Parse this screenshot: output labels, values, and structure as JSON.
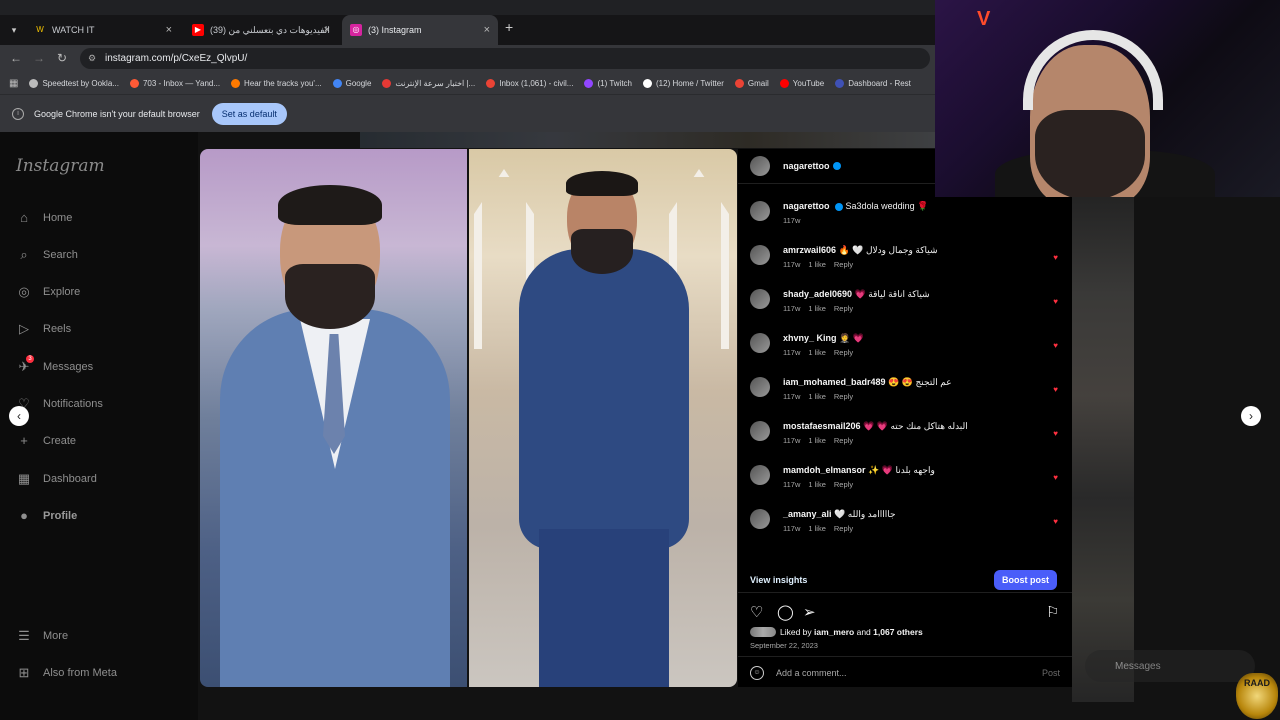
{
  "browser": {
    "tabs": [
      {
        "label": "WATCH IT",
        "fav_color": "#f2c200",
        "fav_glyph": "W"
      },
      {
        "label": "الفيديوهات دي بتعسلني من (39)",
        "fav_color": "#ff0000",
        "fav_glyph": "▶"
      },
      {
        "label": "(3) Instagram",
        "fav_color": "#d6249f",
        "fav_glyph": "◎"
      }
    ],
    "close_glyph": "×",
    "new_tab_glyph": "+",
    "url": "instagram.com/p/CxeEz_QlvpU/",
    "bookmarks": [
      {
        "label": "Speedtest by Ookla...",
        "color": "#bbbbbb"
      },
      {
        "label": "703 - Inbox — Yand...",
        "color": "#ff5a36"
      },
      {
        "label": "Hear the tracks you'...",
        "color": "#ff7a00"
      },
      {
        "label": "Google",
        "color": "#4285f4"
      },
      {
        "label": "اختبار سرعة الإنترنت |...",
        "color": "#e53935"
      },
      {
        "label": "Inbox (1,061) - civil...",
        "color": "#ea4335"
      },
      {
        "label": "(1) Twitch",
        "color": "#9146ff"
      },
      {
        "label": "(12) Home / Twitter",
        "color": "#ffffff"
      },
      {
        "label": "Gmail",
        "color": "#ea4335"
      },
      {
        "label": "YouTube",
        "color": "#ff0000"
      },
      {
        "label": "Dashboard - Rest",
        "color": "#3f51b5"
      }
    ],
    "infobar_message": "Google Chrome isn't your default browser",
    "set_default_label": "Set as default"
  },
  "sidebar": {
    "logo": "Instagram",
    "items": [
      {
        "label": "Home",
        "icon": "⌂"
      },
      {
        "label": "Search",
        "icon": "⌕"
      },
      {
        "label": "Explore",
        "icon": "◎"
      },
      {
        "label": "Reels",
        "icon": "▷"
      },
      {
        "label": "Messages",
        "icon": "✈",
        "badge": "3"
      },
      {
        "label": "Notifications",
        "icon": "♡"
      },
      {
        "label": "Create",
        "icon": "+"
      },
      {
        "label": "Dashboard",
        "icon": "▦"
      },
      {
        "label": "Profile",
        "icon": "●"
      }
    ],
    "more_label": "More",
    "meta_label": "Also from Meta"
  },
  "post": {
    "author": "nagarettoo",
    "caption_user": "nagarettoo",
    "caption": "Sa3dola wedding 🌹",
    "caption_time": "117w",
    "comments": [
      {
        "user": "amrzwail606",
        "text": "🔥 🤍 شياكة وجمال ودلال",
        "time": "117w",
        "likes": "1 like",
        "reply": "Reply"
      },
      {
        "user": "shady_adel0690",
        "text": "💗 شياكة اناقة لياقة",
        "time": "117w",
        "likes": "1 like",
        "reply": "Reply"
      },
      {
        "user": "xhvny_ King",
        "text": "🤵 💗",
        "time": "117w",
        "likes": "1 like",
        "reply": "Reply"
      },
      {
        "user": "iam_mohamed_badr489",
        "text": "😍 😍 عم التجنج",
        "time": "117w",
        "likes": "1 like",
        "reply": "Reply"
      },
      {
        "user": "mostafaesmail206",
        "text": "💗 💗 البدله هتاكل منك حته",
        "time": "117w",
        "likes": "1 like",
        "reply": "Reply"
      },
      {
        "user": "mamdoh_elmansor",
        "text": "✨ 💗 واجهه بلدنا",
        "time": "117w",
        "likes": "1 like",
        "reply": "Reply"
      },
      {
        "user": "_amany_ali",
        "text": "🤍 جااااامد والله",
        "time": "117w",
        "likes": "1 like",
        "reply": "Reply"
      }
    ],
    "view_insights": "View insights",
    "boost_post": "Boost post",
    "liked_by_prefix": "Liked by",
    "liked_by_user": "iam_mero",
    "liked_by_and": "and",
    "liked_by_others": "1,067 others",
    "date": "September 22, 2023",
    "add_comment_placeholder": "Add a comment...",
    "post_button": "Post"
  },
  "overlay": {
    "messages_pill": "Messages",
    "webcam_logo": "V",
    "badge_text": "RAAD"
  }
}
